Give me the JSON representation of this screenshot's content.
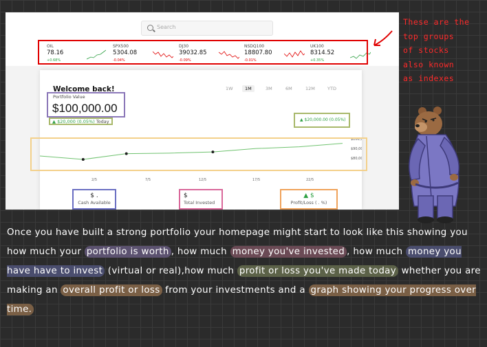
{
  "search": {
    "placeholder": "Search"
  },
  "tickers": [
    {
      "name": "OIL",
      "value": "78.16",
      "change": "+0.68%",
      "trend": "up",
      "color": "#2ea043"
    },
    {
      "name": "SPX500",
      "value": "5304.08",
      "change": "-0.04%",
      "trend": "down",
      "color": "#e00000"
    },
    {
      "name": "DJ30",
      "value": "39032.85",
      "change": "-0.09%",
      "trend": "down",
      "color": "#e00000"
    },
    {
      "name": "NSDQ100",
      "value": "18807.80",
      "change": "-0.01%",
      "trend": "down",
      "color": "#e00000"
    },
    {
      "name": "UK100",
      "value": "8314.52",
      "change": "+0.35%",
      "trend": "up",
      "color": "#2ea043"
    }
  ],
  "portfolio": {
    "welcome": "Welcome back!",
    "value_label": "Portfolio Value",
    "value": "$100,000.00",
    "today_change": "▲ $20,000 (0.05%)",
    "today_label": "Today",
    "profit_change": "▲ $20,000.00 (0.05%)"
  },
  "ranges": [
    {
      "label": "1W",
      "selected": false
    },
    {
      "label": "1M",
      "selected": true
    },
    {
      "label": "3M",
      "selected": false
    },
    {
      "label": "6M",
      "selected": false
    },
    {
      "label": "12M",
      "selected": false
    },
    {
      "label": "YTD",
      "selected": false
    }
  ],
  "chart_data": {
    "type": "line",
    "x": [
      "2/5",
      "7/5",
      "12/5",
      "17/5",
      "22/5"
    ],
    "y_ticks": [
      "$100,000",
      "$90,000",
      "$80,000"
    ],
    "series": [
      {
        "values": [
          87000,
          84000,
          89000,
          89500,
          90500,
          93500,
          95000,
          98000
        ]
      }
    ]
  },
  "cards": {
    "cash": {
      "value": "$ .",
      "label": "Cash Available"
    },
    "invested": {
      "value": "$",
      "label": "Total Invested"
    },
    "profit": {
      "value": "▲ $",
      "label": "Profit/Loss (    .    %)"
    }
  },
  "note": {
    "lines": [
      "These are the",
      "top groups",
      "of stocks",
      "also known",
      "as indexes"
    ]
  },
  "paragraph": {
    "p1": "Once you have built a strong portfolio your homepage might start to look like this showing you how much your ",
    "h1": "portfolio is worth",
    "p2": ", how much ",
    "h2": "money you've invested",
    "p3": ", how much ",
    "h3": "money you have have to invest",
    "p4": " (virtual or real),how much ",
    "h4": "profit or loss you've made today",
    "p5": " whether you are making an ",
    "h5": "overall profit or loss",
    "p6": " from your investments and a ",
    "h6": "graph showing your progress over time.",
    "colors": {
      "h1": "#5c5270",
      "h2": "#6b4a55",
      "h3": "#4a4d6e",
      "h4": "#5c6248",
      "h5": "#7a5f45",
      "h6": "#7a5f45"
    }
  }
}
